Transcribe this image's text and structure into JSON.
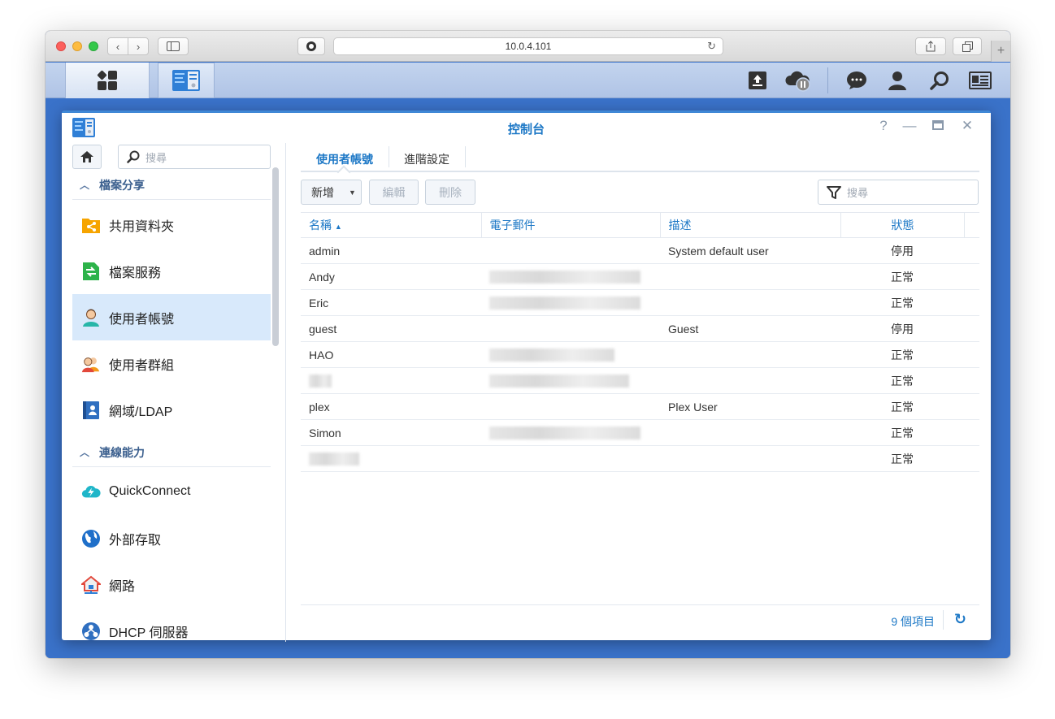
{
  "browser": {
    "url": "10.0.4.101",
    "newtab_label": "+"
  },
  "window": {
    "title": "控制台",
    "help_label": "?"
  },
  "sidebar": {
    "search_placeholder": "搜尋",
    "groups": [
      {
        "label": "檔案分享"
      },
      {
        "label": "連線能力"
      }
    ],
    "items": [
      {
        "label": "共用資料夾",
        "icon": "shared-folder-icon"
      },
      {
        "label": "檔案服務",
        "icon": "file-services-icon"
      },
      {
        "label": "使用者帳號",
        "icon": "user-icon",
        "selected": true
      },
      {
        "label": "使用者群組",
        "icon": "group-icon"
      },
      {
        "label": "網域/LDAP",
        "icon": "domain-icon"
      },
      {
        "label": "QuickConnect",
        "icon": "quickconnect-icon"
      },
      {
        "label": "外部存取",
        "icon": "globe-icon"
      },
      {
        "label": "網路",
        "icon": "network-icon"
      },
      {
        "label": "DHCP 伺服器",
        "icon": "dhcp-icon"
      }
    ]
  },
  "tabs": [
    {
      "label": "使用者帳號",
      "active": true
    },
    {
      "label": "進階設定",
      "active": false
    }
  ],
  "toolbar": {
    "create_label": "新增",
    "edit_label": "編輯",
    "delete_label": "刪除",
    "search_placeholder": "搜尋"
  },
  "table": {
    "columns": [
      "名稱",
      "電子郵件",
      "描述",
      "狀態"
    ],
    "sort_indicator": "▲",
    "rows": [
      {
        "name": "admin",
        "email": "",
        "description": "System default user",
        "status": "停用",
        "disabled": true
      },
      {
        "name": "Andy",
        "email": "",
        "description": "",
        "status": "正常",
        "disabled": false
      },
      {
        "name": "Eric",
        "email": "",
        "description": "",
        "status": "正常",
        "disabled": false
      },
      {
        "name": "guest",
        "email": "",
        "description": "Guest",
        "status": "停用",
        "disabled": true
      },
      {
        "name": "HAO",
        "email": "",
        "description": "",
        "status": "正常",
        "disabled": false
      },
      {
        "name": "",
        "email": "",
        "description": "",
        "status": "正常",
        "disabled": false
      },
      {
        "name": "plex",
        "email": "",
        "description": "Plex User",
        "status": "正常",
        "disabled": false
      },
      {
        "name": "Simon",
        "email": "",
        "description": "",
        "status": "正常",
        "disabled": false
      },
      {
        "name": "",
        "email": "",
        "description": "",
        "status": "正常",
        "disabled": false
      }
    ]
  },
  "footer": {
    "count_label": "9 個項目"
  },
  "colors": {
    "accent": "#1d78c6",
    "disabled_status": "#e03b3b",
    "desktop": "#3a72c9"
  }
}
